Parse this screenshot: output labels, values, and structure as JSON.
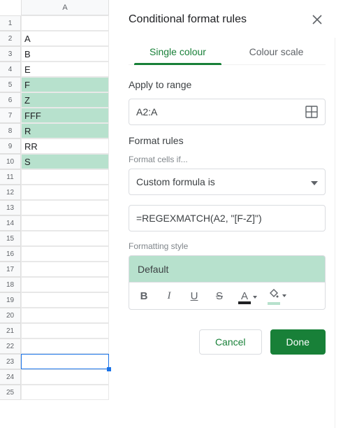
{
  "sheet": {
    "col_label": "A",
    "rows": 25,
    "selected_row": 23,
    "cells": [
      {
        "row": 2,
        "value": "A",
        "hl": false
      },
      {
        "row": 3,
        "value": "B",
        "hl": false
      },
      {
        "row": 4,
        "value": "E",
        "hl": false
      },
      {
        "row": 5,
        "value": "F",
        "hl": true
      },
      {
        "row": 6,
        "value": "Z",
        "hl": true
      },
      {
        "row": 7,
        "value": "FFF",
        "hl": true
      },
      {
        "row": 8,
        "value": "R",
        "hl": true
      },
      {
        "row": 9,
        "value": "RR",
        "hl": false
      },
      {
        "row": 10,
        "value": "S",
        "hl": true
      }
    ]
  },
  "panel": {
    "title": "Conditional format rules",
    "tabs": {
      "single": "Single colour",
      "scale": "Colour scale"
    },
    "apply_label": "Apply to range",
    "range_value": "A2:A",
    "rules_label": "Format rules",
    "cells_if_label": "Format cells if...",
    "condition": "Custom formula is",
    "formula": "=REGEXMATCH(A2, \"[F-Z]\")",
    "style_label": "Formatting style",
    "style_name": "Default",
    "toolbar": {
      "bold": "B",
      "italic": "I",
      "underline": "U",
      "strike": "S",
      "textcolor": "A"
    },
    "actions": {
      "cancel": "Cancel",
      "done": "Done"
    }
  }
}
